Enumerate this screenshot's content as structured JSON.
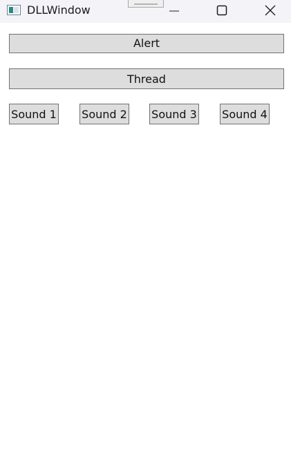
{
  "window": {
    "title": "DLLWindow",
    "icon": "app-window-icon",
    "controls": [
      "minimize-icon",
      "maximize-icon",
      "close-icon"
    ]
  },
  "buttons": {
    "alert": "Alert",
    "thread": "Thread",
    "sounds": [
      "Sound 1",
      "Sound 2",
      "Sound 3",
      "Sound 4"
    ]
  },
  "colors": {
    "titlebar": "#f3f3f8",
    "button_face": "#dddddd",
    "button_border": "#707070"
  }
}
